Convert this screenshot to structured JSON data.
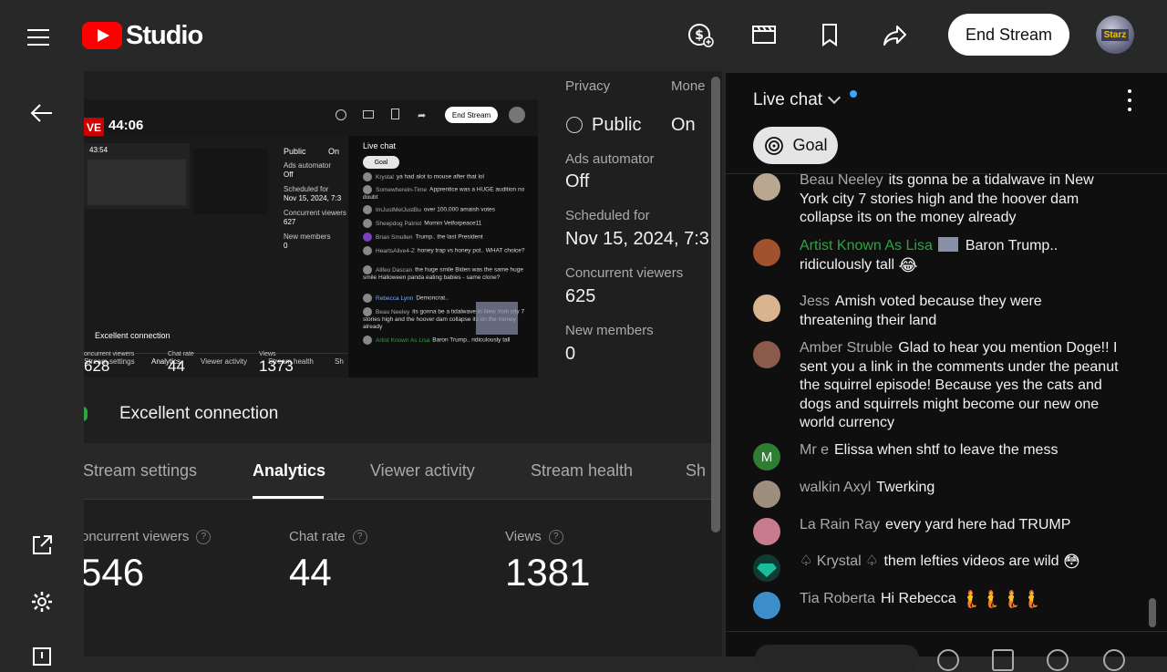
{
  "app": {
    "logo_text": "Studio",
    "end_stream_label": "End Stream",
    "avatar_text": "Starz"
  },
  "preview": {
    "live_badge": "VE",
    "timer": "44:06",
    "mini": {
      "end_stream": "End Stream",
      "timer": "43:54",
      "privacy_public": "Public",
      "monetization_on": "On",
      "ads": "Ads automator",
      "ads_value": "Off",
      "scheduled": "Scheduled for",
      "scheduled_value": "Nov 15, 2024, 7:3",
      "concurrent": "Concurrent viewers",
      "concurrent_value": "627",
      "new_members": "New members",
      "new_members_value": "0",
      "connection": "Excellent connection",
      "tabs": [
        "Stream settings",
        "Analytics",
        "Viewer activity",
        "Stream health",
        "Sh"
      ],
      "stats_labels": [
        "oncurrent viewers",
        "Chat rate",
        "Views"
      ],
      "stats_values": [
        "628",
        "44",
        "1373"
      ],
      "chat_title": "Live chat",
      "goal": "Goal",
      "chat_rows": [
        {
          "a": "Krystal",
          "t": "ya had alot to mouse after that lol"
        },
        {
          "a": "Somewherein-Time",
          "t": "Apprentice was a HUGE audition no doubt"
        },
        {
          "a": "ImJustMeIJustBu",
          "t": "over 100,000 amaish votes"
        },
        {
          "a": "Sheepdog Patriot",
          "t": "Mornin Vetforpeace11"
        },
        {
          "a": "Brian Smullen",
          "t": "Trump.. the last President"
        },
        {
          "a": "HeartsAlive4-Z",
          "t": "honey trap vs honey pot.. WHAT choice?"
        },
        {
          "a": "Alifeo Dascan",
          "t": "the huge smile Biden was the same huge smile Halloween panda eating babies - same clone?"
        },
        {
          "a": "Rebecca Lynn",
          "t": "Demoncrat.."
        },
        {
          "a": "Beau Neeley",
          "t": "its gonna be a tidalwave in New York city 7 stories high and the hoover dam collapse its on the money already"
        },
        {
          "a": "Artist Known As Lisa",
          "t": "Baron Trump.. ridiculously tall"
        }
      ]
    }
  },
  "info": {
    "privacy_label": "Privacy",
    "privacy_value": "Public",
    "monetization_label": "Mone",
    "monetization_value": "On",
    "ads_label": "Ads automator",
    "ads_value": "Off",
    "scheduled_label": "Scheduled for",
    "scheduled_value": "Nov 15, 2024, 7:3",
    "concurrent_label": "Concurrent viewers",
    "concurrent_value": "625",
    "new_members_label": "New members",
    "new_members_value": "0"
  },
  "connection": {
    "text": "Excellent connection"
  },
  "tabs": [
    {
      "label": "Stream settings"
    },
    {
      "label": "Analytics"
    },
    {
      "label": "Viewer activity"
    },
    {
      "label": "Stream health"
    },
    {
      "label": "Sh"
    }
  ],
  "stats": [
    {
      "label": "oncurrent viewers",
      "value": "546"
    },
    {
      "label": "Chat rate",
      "value": "44"
    },
    {
      "label": "Views",
      "value": "1381"
    }
  ],
  "chat": {
    "title": "Live chat",
    "goal_label": "Goal",
    "messages": [
      {
        "author": "Beau Neeley",
        "text": "its gonna be a tidalwave in New York city 7 stories high and the hoover dam collapse its on the money already",
        "avatar_color": "#b9a78f",
        "member": false
      },
      {
        "author": "Artist Known As Lisa",
        "text": "Baron Trump.. ridiculously tall",
        "emoji": "😂",
        "avatar_color": "#a0522d",
        "member": true
      },
      {
        "author": "Jess",
        "text": "Amish voted because they were threatening their land",
        "avatar_color": "#d9b48f",
        "member": false
      },
      {
        "author": "Amber Struble",
        "text": "Glad to hear you mention Doge!! I sent you a link in the comments under the peanut the squirrel episode! Because yes the cats and dogs and squirrels might become our new one world currency",
        "avatar_color": "#8a5a4a",
        "member": false
      },
      {
        "author": "Mr e",
        "avatar_letter": "M",
        "text": "Elissa when shtf to leave the mess",
        "avatar_color": "#2e7d32",
        "member": false
      },
      {
        "author": "walkin Axyl",
        "text": "Twerking",
        "avatar_color": "#9e8e7e",
        "member": false
      },
      {
        "author": "La Rain Ray",
        "text": "every yard here had TRUMP",
        "avatar_color": "#c97b8e",
        "member": false
      },
      {
        "author": "♤ Krystal ♤",
        "text": "them lefties videos are wild",
        "emoji": "😳",
        "avatar_color": "#1abc9c",
        "member": false
      },
      {
        "author": "Tia Roberta",
        "text": "Hi Rebecca",
        "emoji": "🧜🧜🧜🧜",
        "avatar_color": "#3b8ec9",
        "member": false
      }
    ]
  },
  "colors": {
    "accent_red": "#ff0000",
    "member_green": "#2ba640",
    "link_blue": "#3ea6ff"
  },
  "icons": [
    "menu-icon",
    "monetization-icon",
    "clapperboard-icon",
    "bookmark-icon",
    "share-icon",
    "back-arrow-icon",
    "external-link-icon",
    "settings-icon",
    "feedback-icon"
  ]
}
